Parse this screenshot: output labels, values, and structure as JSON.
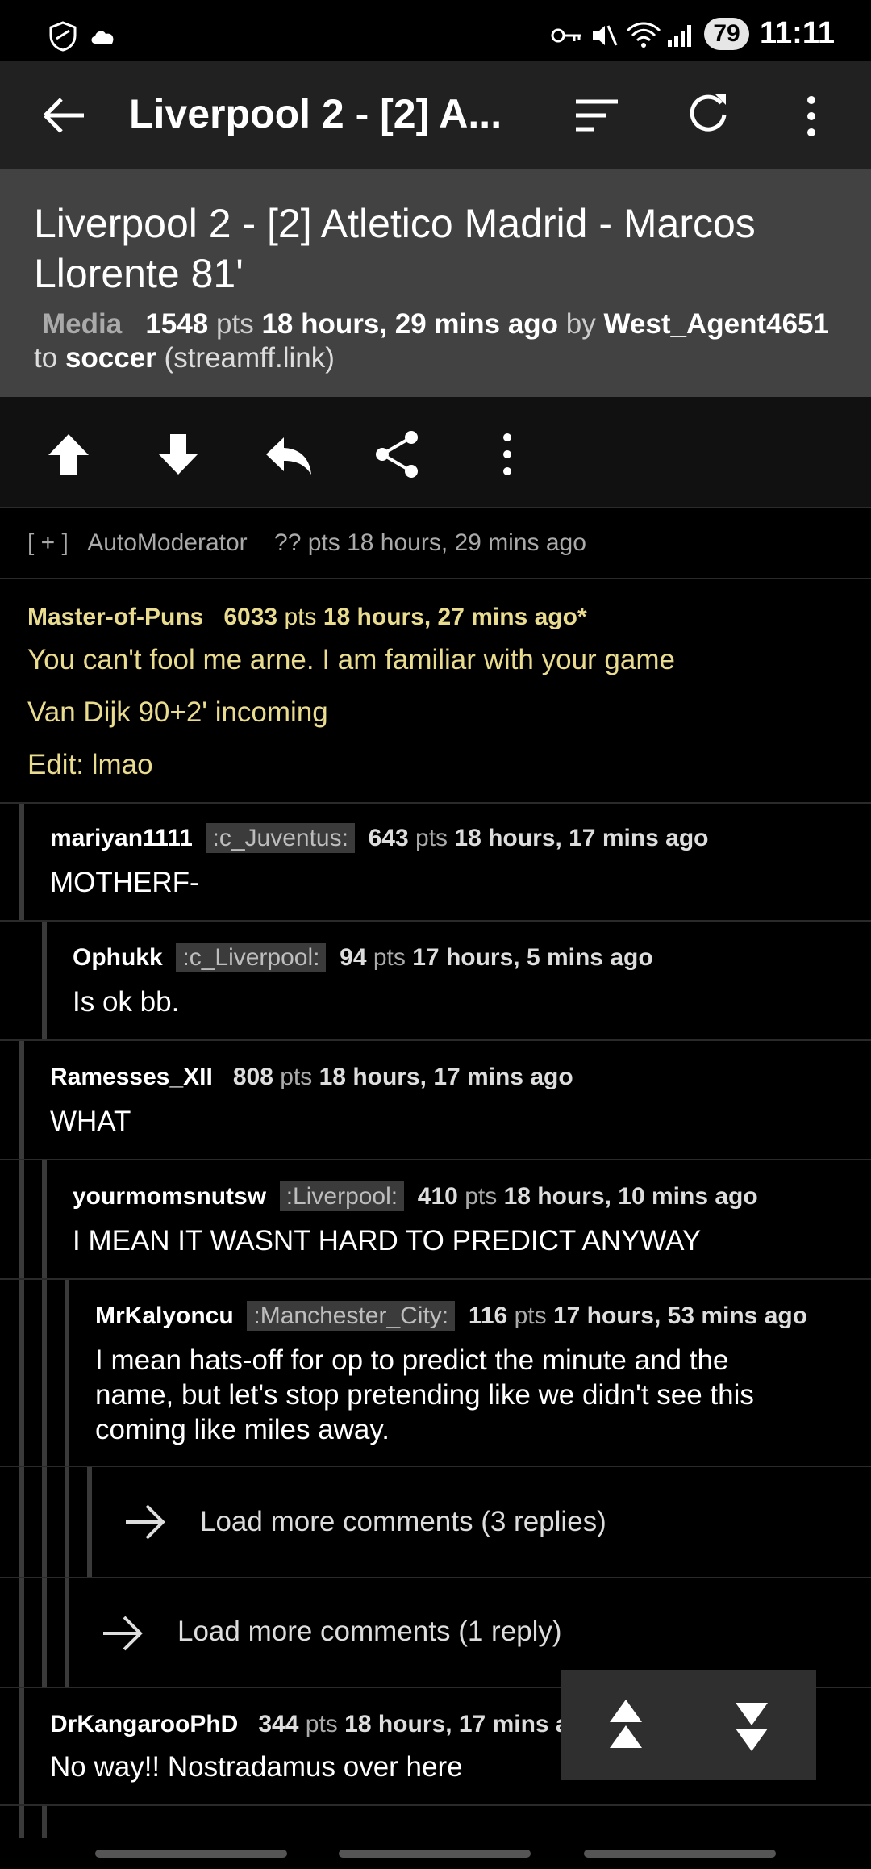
{
  "status": {
    "battery": "79",
    "time": "11:11"
  },
  "appbar": {
    "title": "Liverpool 2 - [2] A..."
  },
  "post": {
    "title": "Liverpool 2 - [2] Atletico Madrid - Marcos Llorente 81'",
    "type": "Media",
    "points": "1548",
    "pts_label": "pts",
    "time": "18 hours, 29 mins ago",
    "by": "by",
    "author": "West_Agent4651",
    "to": "to",
    "subreddit": "soccer",
    "domain": "(streamff.link)"
  },
  "collapsed": {
    "expander": "[ + ]",
    "author": "AutoModerator",
    "meta": "?? pts 18 hours, 29 mins ago"
  },
  "comments": [
    {
      "author": "Master-of-Puns",
      "flair": "",
      "points": "6033",
      "time": "18 hours, 27 mins ago*",
      "lines": [
        "You can't fool me arne. I am familiar with your game",
        "Van Dijk 90+2' incoming",
        "Edit: lmao"
      ]
    },
    {
      "author": "mariyan1111",
      "flair": ":c_Juventus:",
      "points": "643",
      "time": "18 hours, 17 mins ago",
      "body": "MOTHERF-"
    },
    {
      "author": "Ophukk",
      "flair": ":c_Liverpool:",
      "points": "94",
      "time": "17 hours, 5 mins ago",
      "body": "Is ok bb."
    },
    {
      "author": "Ramesses_XII",
      "flair": "",
      "points": "808",
      "time": "18 hours, 17 mins ago",
      "body": "WHAT"
    },
    {
      "author": "yourmomsnutsw",
      "flair": ":Liverpool:",
      "points": "410",
      "time": "18 hours, 10 mins ago",
      "body": "I MEAN IT WASNT HARD TO PREDICT ANYWAY"
    },
    {
      "author": "MrKalyoncu",
      "flair": ":Manchester_City:",
      "points": "116",
      "time": "17 hours, 53 mins ago",
      "body": "I mean hats-off for op to predict the minute and the name, but let's stop pretending like we didn't see this coming like miles away."
    },
    {
      "author": "DrKangarooPhD",
      "flair": "",
      "points": "344",
      "time": "18 hours, 17 mins ago",
      "body": "No way!! Nostradamus over here"
    }
  ],
  "pts_label": "pts",
  "load_more": [
    "Load more comments (3 replies)",
    "Load more comments (1 reply)"
  ],
  "colors": {
    "accent_gold": "#e9dc8f",
    "header_bg": "#424242",
    "appbar_bg": "#212121"
  }
}
